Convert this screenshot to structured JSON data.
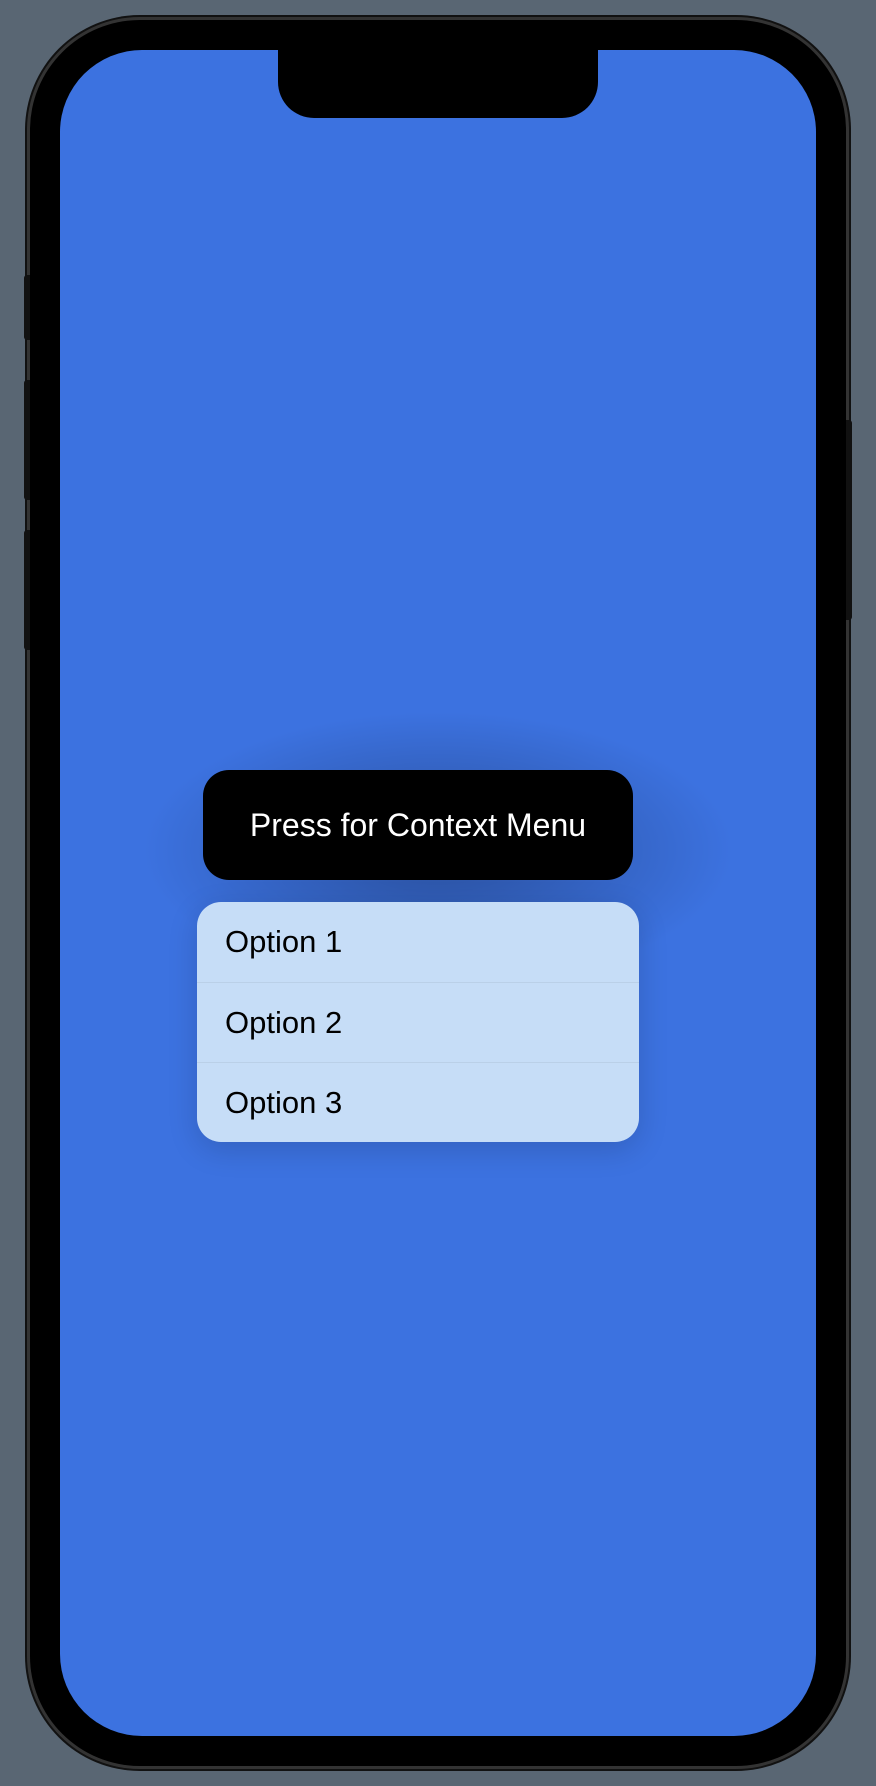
{
  "button": {
    "label": "Press for Context Menu"
  },
  "menu": {
    "items": [
      {
        "label": "Option 1"
      },
      {
        "label": "Option 2"
      },
      {
        "label": "Option 3"
      }
    ]
  }
}
